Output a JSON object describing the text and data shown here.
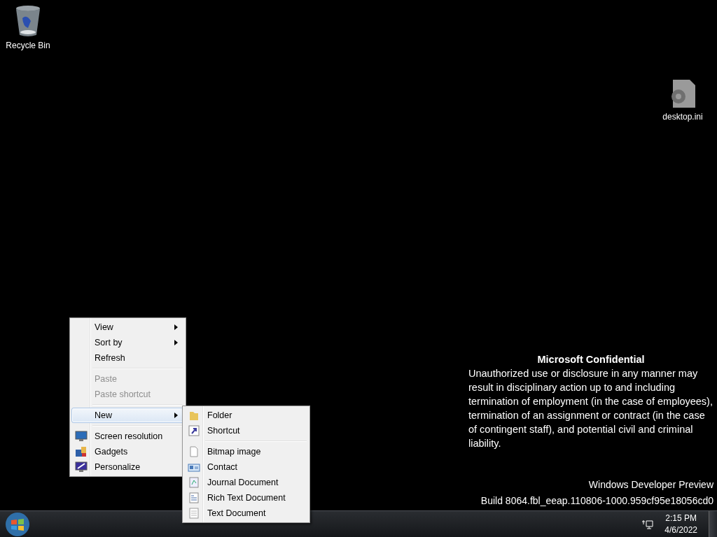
{
  "desktop_icons": [
    {
      "label": "Recycle Bin",
      "kind": "recycle"
    },
    {
      "label": "desktop.ini",
      "kind": "settings-file"
    }
  ],
  "context_menu": {
    "items": [
      {
        "kind": "submenu",
        "label": "View",
        "disabled": false,
        "selected": false
      },
      {
        "kind": "submenu",
        "label": "Sort by",
        "disabled": false,
        "selected": false
      },
      {
        "kind": "text",
        "label": "Refresh",
        "disabled": false,
        "selected": false
      },
      {
        "kind": "separator"
      },
      {
        "kind": "text",
        "label": "Paste",
        "disabled": true,
        "selected": false
      },
      {
        "kind": "text",
        "label": "Paste shortcut",
        "disabled": true,
        "selected": false
      },
      {
        "kind": "separator"
      },
      {
        "kind": "submenu",
        "label": "New",
        "disabled": false,
        "selected": true
      },
      {
        "kind": "separator"
      },
      {
        "kind": "monitor",
        "label": "Screen resolution",
        "disabled": false,
        "selected": false
      },
      {
        "kind": "gadgets",
        "label": "Gadgets",
        "disabled": false,
        "selected": false
      },
      {
        "kind": "paint",
        "label": "Personalize",
        "disabled": false,
        "selected": false
      }
    ]
  },
  "new_submenu": {
    "items": [
      {
        "kind": "folder",
        "label": "Folder"
      },
      {
        "kind": "shortcut",
        "label": "Shortcut"
      },
      {
        "kind": "separator"
      },
      {
        "kind": "blank",
        "label": "Bitmap image"
      },
      {
        "kind": "contact",
        "label": "Contact"
      },
      {
        "kind": "journal",
        "label": "Journal Document"
      },
      {
        "kind": "richtext",
        "label": "Rich Text Document"
      },
      {
        "kind": "lines",
        "label": "Text Document"
      }
    ]
  },
  "watermark": {
    "title": "Microsoft Confidential",
    "body": "Unauthorized use or disclosure in any manner may result in disciplinary action up to and including termination of employment (in the case of employees), termination of an assignment or contract (in the case of contingent staff), and potential civil and criminal liability.",
    "edition": "Windows Developer Preview",
    "build": "Build 8064.fbl_eeap.110806-1000.959cf95e18056cd0"
  },
  "taskbar": {
    "time": "2:15 PM",
    "date": "4/6/2022"
  }
}
